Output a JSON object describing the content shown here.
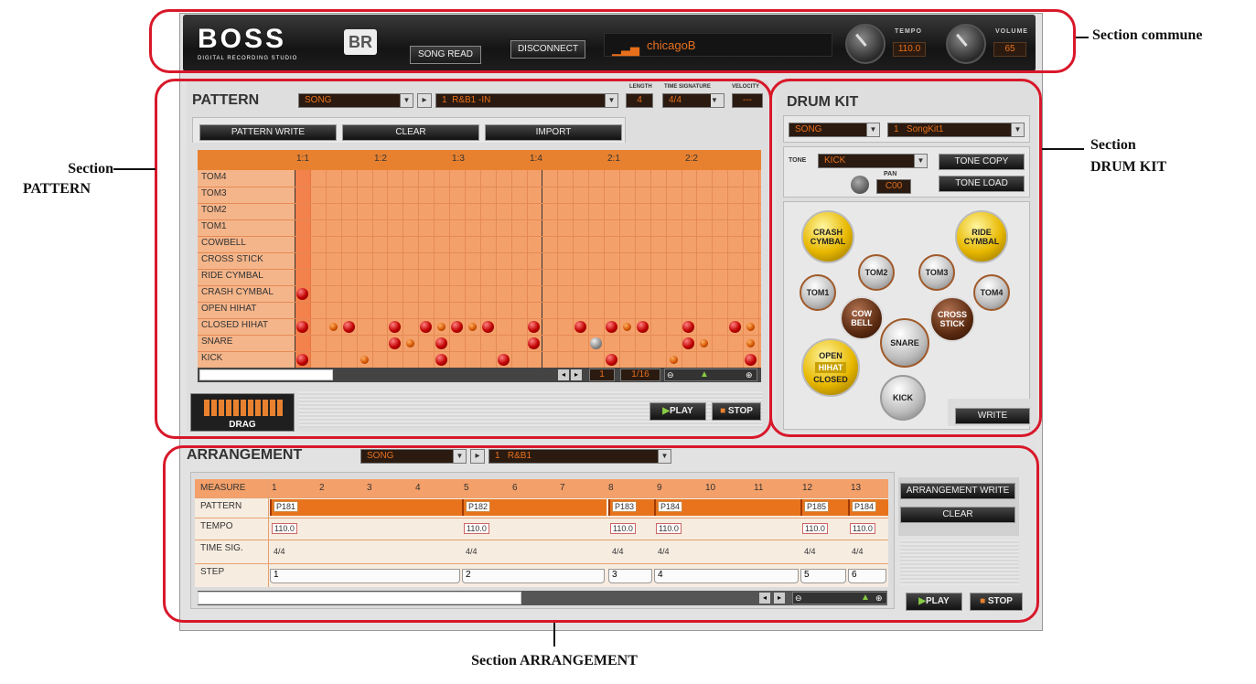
{
  "header": {
    "brand": "BOSS",
    "brand_sub": "DIGITAL RECORDING STUDIO",
    "br_logo": "BR",
    "song_read": "SONG READ",
    "disconnect": "DISCONNECT",
    "song_name": "chicagoB",
    "tempo_label": "TEMPO",
    "tempo_value": "110.0",
    "volume_label": "VOLUME",
    "volume_value": "65"
  },
  "pattern": {
    "title": "PATTERN",
    "source": "SONG",
    "pattern_number": "1",
    "pattern_name": "R&B1 -IN",
    "length_label": "LENGTH",
    "length_value": "4",
    "time_sig_label": "TIME SIGNATURE",
    "time_sig_value": "4/4",
    "velocity_label": "VELOCITY",
    "velocity_value": "---",
    "buttons": {
      "write": "PATTERN WRITE",
      "clear": "CLEAR",
      "import": "IMPORT"
    },
    "beats": [
      "1:1",
      "1:2",
      "1:3",
      "1:4",
      "2:1",
      "2:2"
    ],
    "rows": [
      "TOM4",
      "TOM3",
      "TOM2",
      "TOM1",
      "COWBELL",
      "CROSS STICK",
      "RIDE CYMBAL",
      "CRASH CYMBAL",
      "OPEN HIHAT",
      "CLOSED HIHAT",
      "SNARE",
      "KICK"
    ],
    "position": "1",
    "resolution": "1/16",
    "drag": "DRAG",
    "play": "PLAY",
    "stop": "STOP"
  },
  "drumkit": {
    "title": "DRUM KIT",
    "source": "SONG",
    "kit_number": "1",
    "kit_name": "SongKit1",
    "tone_label": "TONE",
    "tone_value": "KICK",
    "pan_label": "PAN",
    "pan_value": "C00",
    "tone_copy": "TONE COPY",
    "tone_load": "TONE LOAD",
    "pads": {
      "crash": "CRASH CYMBAL",
      "ride": "RIDE CYMBAL",
      "tom1": "TOM1",
      "tom2": "TOM2",
      "tom3": "TOM3",
      "tom4": "TOM4",
      "cowbell": "COW BELL",
      "cross": "CROSS STICK",
      "snare": "SNARE",
      "open": "OPEN",
      "hihat": "HIHAT",
      "closed": "CLOSED",
      "kick": "KICK"
    },
    "write": "WRITE"
  },
  "arrangement": {
    "title": "ARRANGEMENT",
    "source": "SONG",
    "number": "1",
    "name": "R&B1",
    "row_labels": [
      "MEASURE",
      "PATTERN",
      "TEMPO",
      "TIME SIG.",
      "STEP"
    ],
    "measures": [
      "1",
      "2",
      "3",
      "4",
      "5",
      "6",
      "7",
      "8",
      "9",
      "10",
      "11",
      "12",
      "13"
    ],
    "patterns": [
      "P181",
      "P182",
      "P183",
      "P184",
      "P185",
      "P184"
    ],
    "tempos": [
      "110.0",
      "110.0",
      "110.0",
      "110.0",
      "110.0",
      "110.0"
    ],
    "timesigs": [
      "4/4",
      "4/4",
      "4/4",
      "4/4",
      "4/4",
      "4/4"
    ],
    "steps": [
      "1",
      "2",
      "3",
      "4",
      "5",
      "6"
    ],
    "write": "ARRANGEMENT WRITE",
    "clear": "CLEAR",
    "play": "PLAY",
    "stop": "STOP"
  },
  "annotations": {
    "common": "Section commune",
    "pattern_1": "Section",
    "pattern_2": "PATTERN",
    "drumkit_1": "Section",
    "drumkit_2": "DRUM KIT",
    "arrangement": "Section ARRANGEMENT"
  },
  "colors": {
    "accent": "#e8812f",
    "highlight": "#d8182a",
    "lcd_text": "#e8701c"
  }
}
